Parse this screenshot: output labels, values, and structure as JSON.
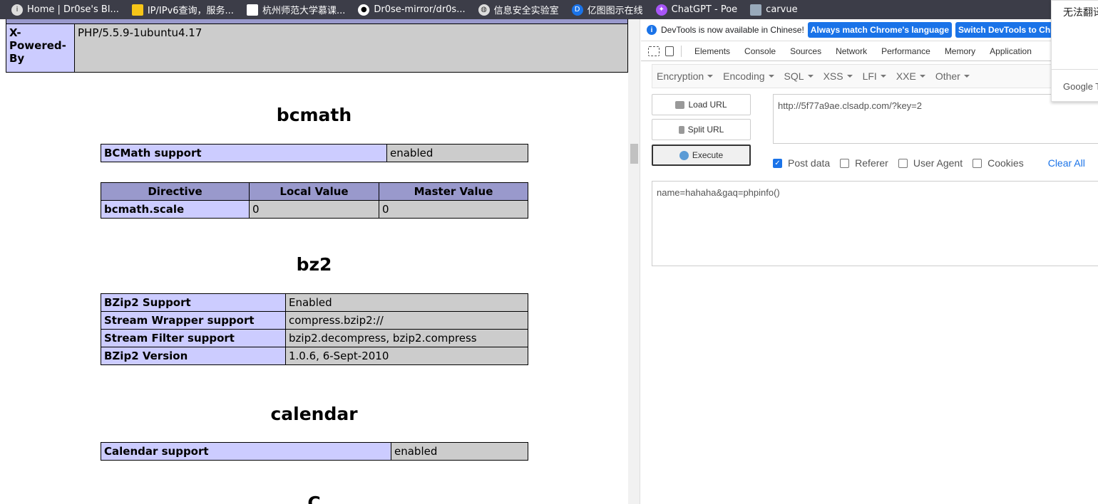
{
  "bookmarks": [
    {
      "label": "Home | Dr0se's Bl...",
      "icon": "info-icon"
    },
    {
      "label": "IP/IPv6查询，服务...",
      "icon": "ip-icon"
    },
    {
      "label": "杭州师范大学慕课...",
      "icon": "page-icon"
    },
    {
      "label": "Dr0se-mirror/dr0s...",
      "icon": "github-icon"
    },
    {
      "label": "信息安全实验室",
      "icon": "globe-icon"
    },
    {
      "label": "亿图图示在线",
      "icon": "edraw-icon"
    },
    {
      "label": "ChatGPT - Poe",
      "icon": "poe-icon"
    },
    {
      "label": "carvue",
      "icon": "carvue-icon"
    }
  ],
  "phpinfo": {
    "top_row": {
      "key": "X-Powered-By",
      "value": "PHP/5.5.9-1ubuntu4.17"
    },
    "bcmath": {
      "title": "bcmath",
      "support": {
        "key": "BCMath support",
        "value": "enabled"
      },
      "directive_headers": [
        "Directive",
        "Local Value",
        "Master Value"
      ],
      "directives": [
        {
          "name": "bcmath.scale",
          "local": "0",
          "master": "0"
        }
      ]
    },
    "bz2": {
      "title": "bz2",
      "rows": [
        {
          "key": "BZip2 Support",
          "value": "Enabled"
        },
        {
          "key": "Stream Wrapper support",
          "value": "compress.bzip2://"
        },
        {
          "key": "Stream Filter support",
          "value": "bzip2.decompress, bzip2.compress"
        },
        {
          "key": "BZip2 Version",
          "value": "1.0.6, 6-Sept-2010"
        }
      ]
    },
    "calendar": {
      "title": "calendar",
      "support": {
        "key": "Calendar support",
        "value": "enabled"
      }
    },
    "next_title": "C"
  },
  "devtools": {
    "infobar": {
      "message": "DevTools is now available in Chinese!",
      "btn_match": "Always match Chrome's language",
      "btn_switch": "Switch DevTools to Chinese"
    },
    "tabs": [
      "Elements",
      "Console",
      "Sources",
      "Network",
      "Performance",
      "Memory",
      "Application"
    ]
  },
  "hackbar": {
    "menus": [
      "Encryption",
      "Encoding",
      "SQL",
      "XSS",
      "LFI",
      "XXE",
      "Other"
    ],
    "load_url": "Load URL",
    "split_url": "Split URL",
    "execute": "Execute",
    "url": "http://5f77a9ae.clsadp.com/?key=2",
    "options": [
      {
        "label": "Post data",
        "checked": true
      },
      {
        "label": "Referer",
        "checked": false
      },
      {
        "label": "User Agent",
        "checked": false
      },
      {
        "label": "Cookies",
        "checked": false
      }
    ],
    "clear_all": "Clear All",
    "post_data": "name=hahaha&gaq=phpinfo()"
  },
  "translate": {
    "title": "无法翻译",
    "brand": "Google Translate"
  },
  "colors": {
    "phpinfo_key_bg": "#ccccff",
    "phpinfo_value_bg": "#cccccc",
    "phpinfo_header_bg": "#9999cc",
    "accent": "#1a73e8"
  }
}
